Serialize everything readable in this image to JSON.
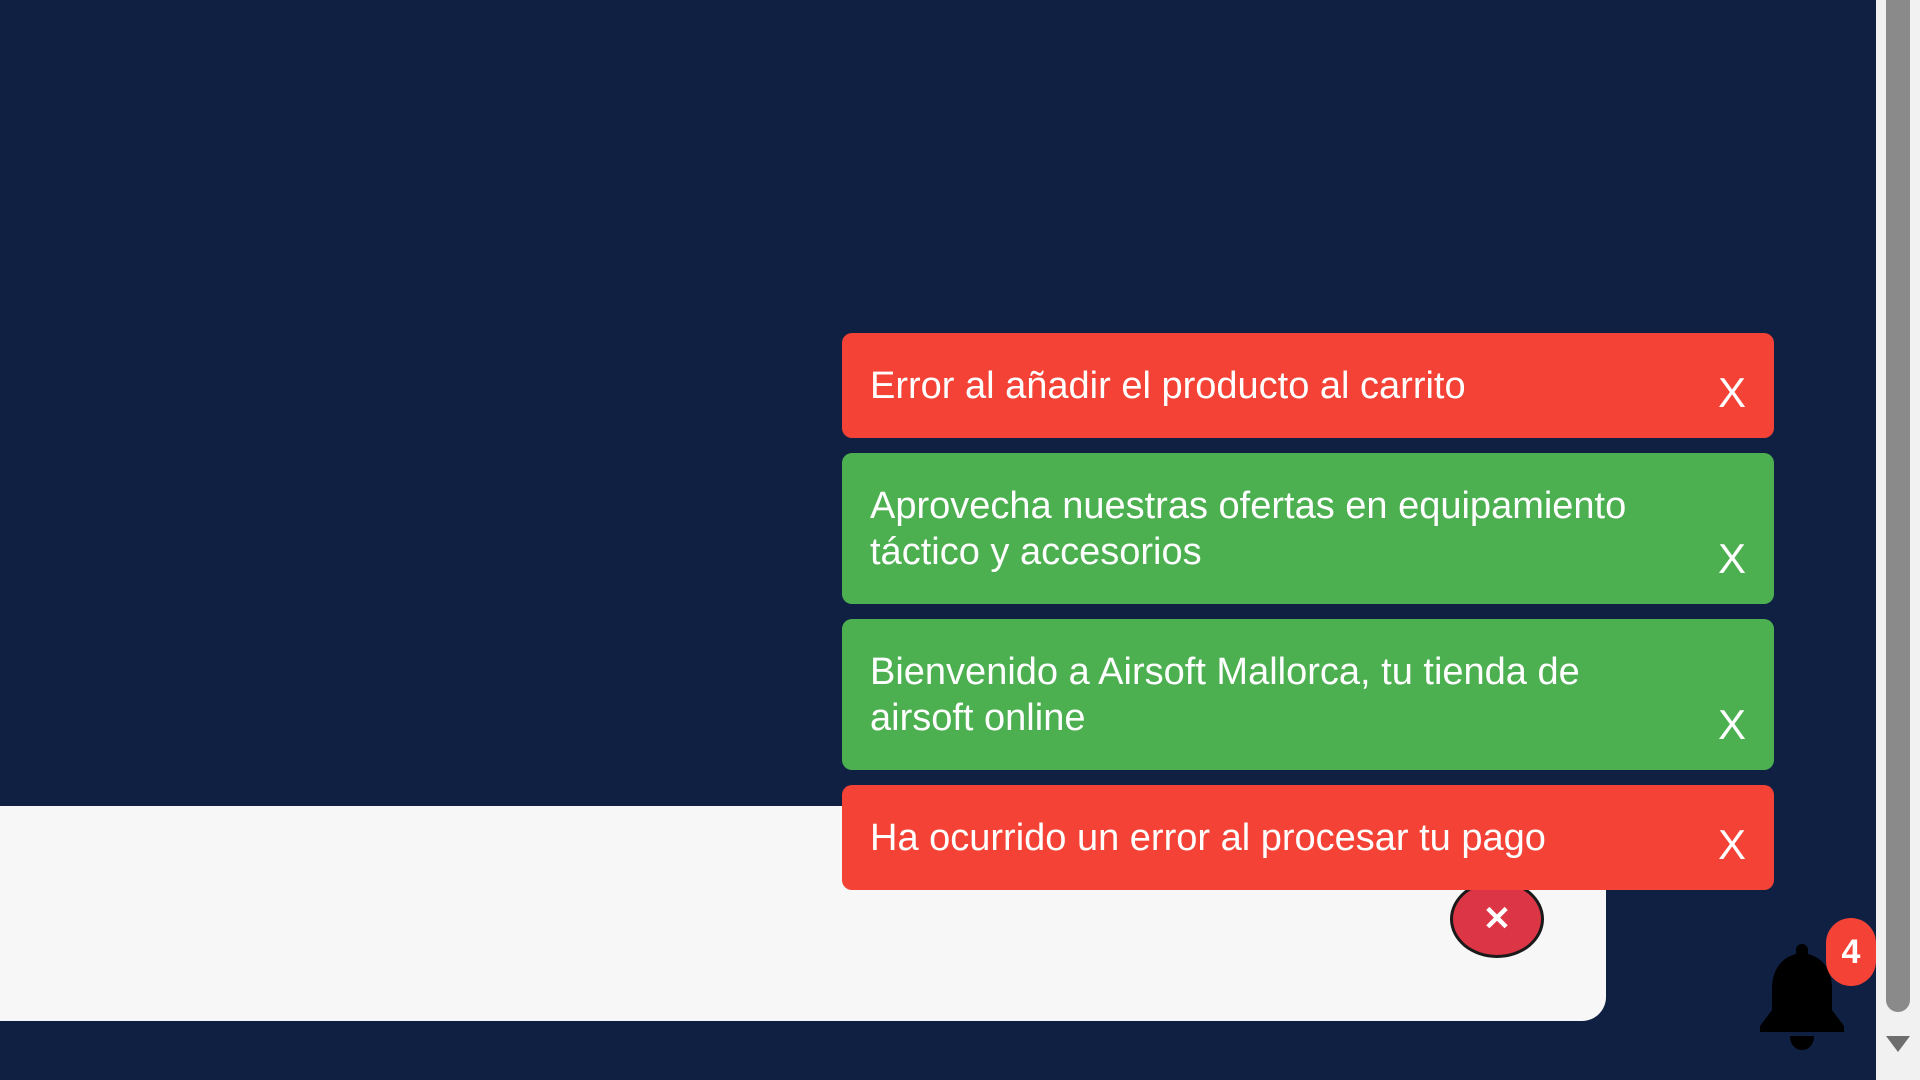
{
  "toasts": [
    {
      "type": "error",
      "message": "Error al añadir el producto al carrito",
      "close_label": "X"
    },
    {
      "type": "success",
      "message": "Aprovecha nuestras ofertas en equipamiento táctico y accesorios",
      "close_label": "X"
    },
    {
      "type": "success",
      "message": "Bienvenido a Airsoft Mallorca, tu tienda de airsoft online",
      "close_label": "X"
    },
    {
      "type": "error",
      "message": "Ha ocurrido un error al procesar tu pago",
      "close_label": "X"
    }
  ],
  "panel": {
    "close_symbol": "✕"
  },
  "notifications": {
    "icon": "bell-icon",
    "count": "4"
  },
  "colors": {
    "background": "#0f2042",
    "error": "#f44336",
    "success": "#4caf50",
    "panel": "#f7f7f7",
    "panel_close": "#dc3545"
  }
}
